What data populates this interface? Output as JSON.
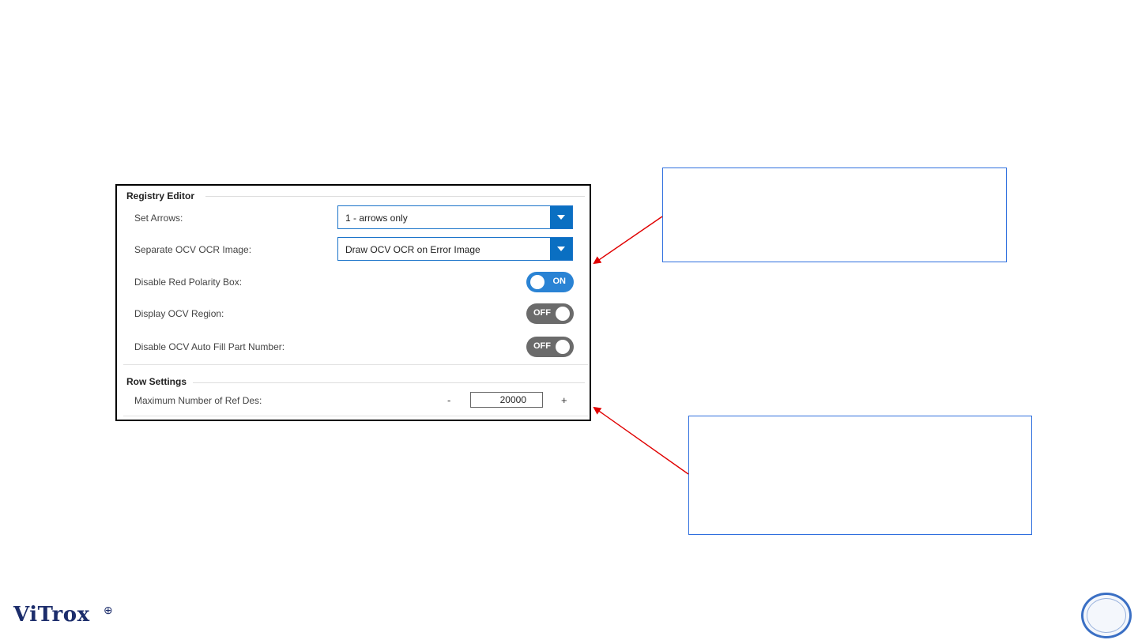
{
  "registry_editor": {
    "title": "Registry Editor",
    "set_arrows": {
      "label": "Set Arrows:",
      "value": "1 - arrows only"
    },
    "separate_ocv_ocr_image": {
      "label": "Separate OCV OCR Image:",
      "value": "Draw OCV OCR on Error Image"
    },
    "disable_red_polarity_box": {
      "label": "Disable Red Polarity Box:",
      "state": "ON"
    },
    "display_ocv_region": {
      "label": "Display OCV Region:",
      "state": "OFF"
    },
    "disable_ocv_auto_fill": {
      "label": "Disable OCV Auto Fill Part Number:",
      "state": "OFF"
    }
  },
  "row_settings": {
    "title": "Row Settings",
    "max_ref_des": {
      "label": "Maximum Number of Ref Des:",
      "minus": "-",
      "value": "20000",
      "plus": "+"
    }
  },
  "logo": {
    "text": "ViTrox",
    "mark": "⊕"
  },
  "colors": {
    "accent": "#0a6fc2",
    "toggle_on": "#2a83d4",
    "toggle_off": "#6b6b6b",
    "callout_border": "#2f6fde",
    "arrow": "#e00000"
  }
}
